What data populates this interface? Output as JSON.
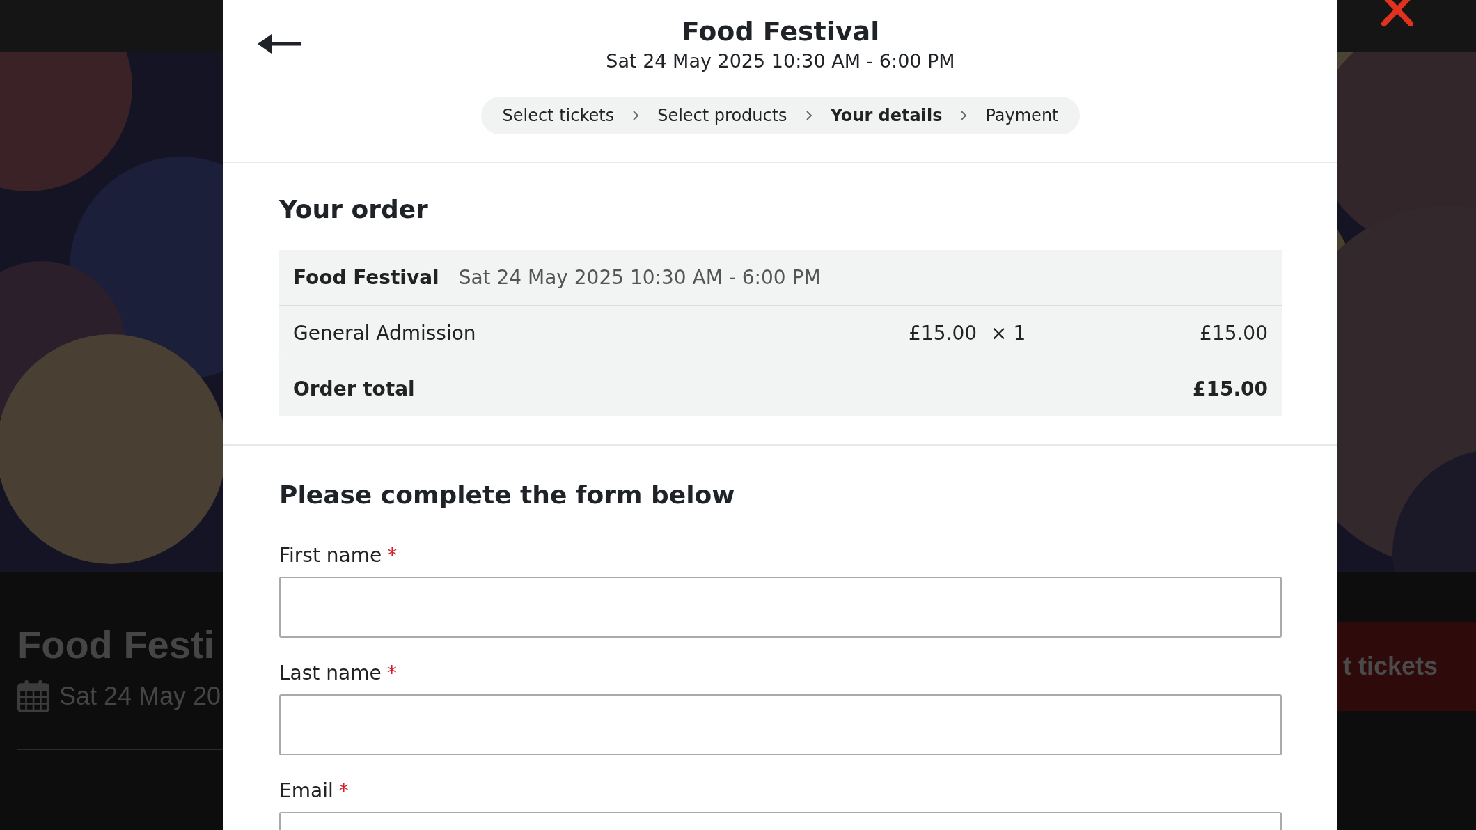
{
  "background_page": {
    "title": "Food Festi",
    "date": "Sat 24 May 20",
    "button": "t tickets"
  },
  "modal": {
    "title": "Food Festival",
    "subtitle": "Sat 24 May 2025 10:30 AM - 6:00 PM",
    "steps": [
      {
        "label": "Select tickets",
        "selected": false
      },
      {
        "label": "Select products",
        "selected": false
      },
      {
        "label": "Your details",
        "selected": true
      },
      {
        "label": "Payment",
        "selected": false
      }
    ],
    "order": {
      "heading": "Your order",
      "event": {
        "name": "Food Festival",
        "date": "Sat 24 May 2025 10:30 AM - 6:00 PM"
      },
      "lines": [
        {
          "name": "General Admission",
          "price": "£15.00",
          "quantity": "× 1",
          "total": "£15.00"
        }
      ],
      "total": {
        "label": "Order total",
        "amount": "£15.00"
      }
    },
    "form": {
      "heading": "Please complete the form below",
      "fields": [
        {
          "label": "First name",
          "required_mark": "*"
        },
        {
          "label": "Last name",
          "required_mark": "*"
        },
        {
          "label": "Email",
          "required_mark": "*"
        }
      ]
    }
  }
}
